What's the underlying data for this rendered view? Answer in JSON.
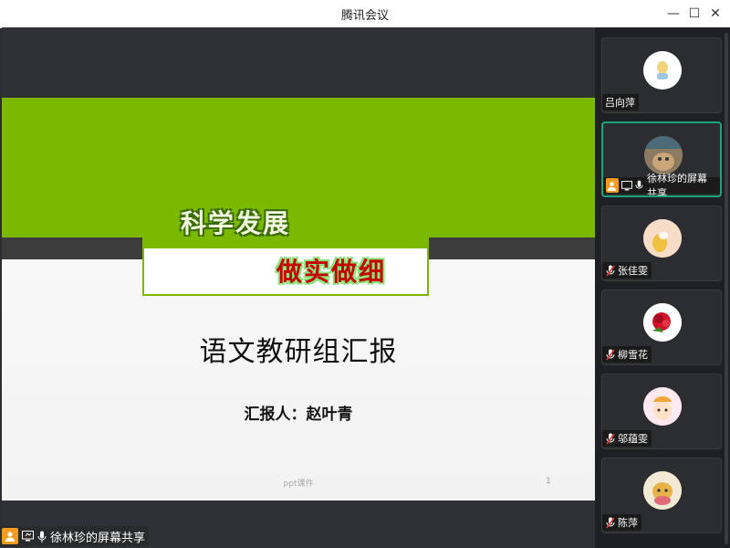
{
  "window": {
    "title": "腾讯会议",
    "controls": {
      "minimize": "—",
      "maximize": "☐",
      "close": "✕"
    }
  },
  "slide": {
    "banner_top_text": "科学发展",
    "banner_bottom_text": "做实做细",
    "title": "语文教研组汇报",
    "reporter": "汇报人：赵叶青",
    "footer_note": "ppt课件",
    "page_number": "1"
  },
  "share_badge": {
    "label": "徐林珍的屏幕共享"
  },
  "participants": [
    {
      "name": "吕向萍",
      "muted": false,
      "active": false
    },
    {
      "name": "徐林珍的屏幕共享",
      "muted": false,
      "active": true,
      "sharing": true
    },
    {
      "name": "张佳雯",
      "muted": true,
      "active": false
    },
    {
      "name": "柳雪花",
      "muted": true,
      "active": false
    },
    {
      "name": "邬蕴雯",
      "muted": true,
      "active": false
    },
    {
      "name": "陈萍",
      "muted": true,
      "active": false
    }
  ],
  "colors": {
    "slide_green": "#7ab900",
    "active_border": "#1aa37a",
    "badge_orange": "#f39c1f"
  }
}
